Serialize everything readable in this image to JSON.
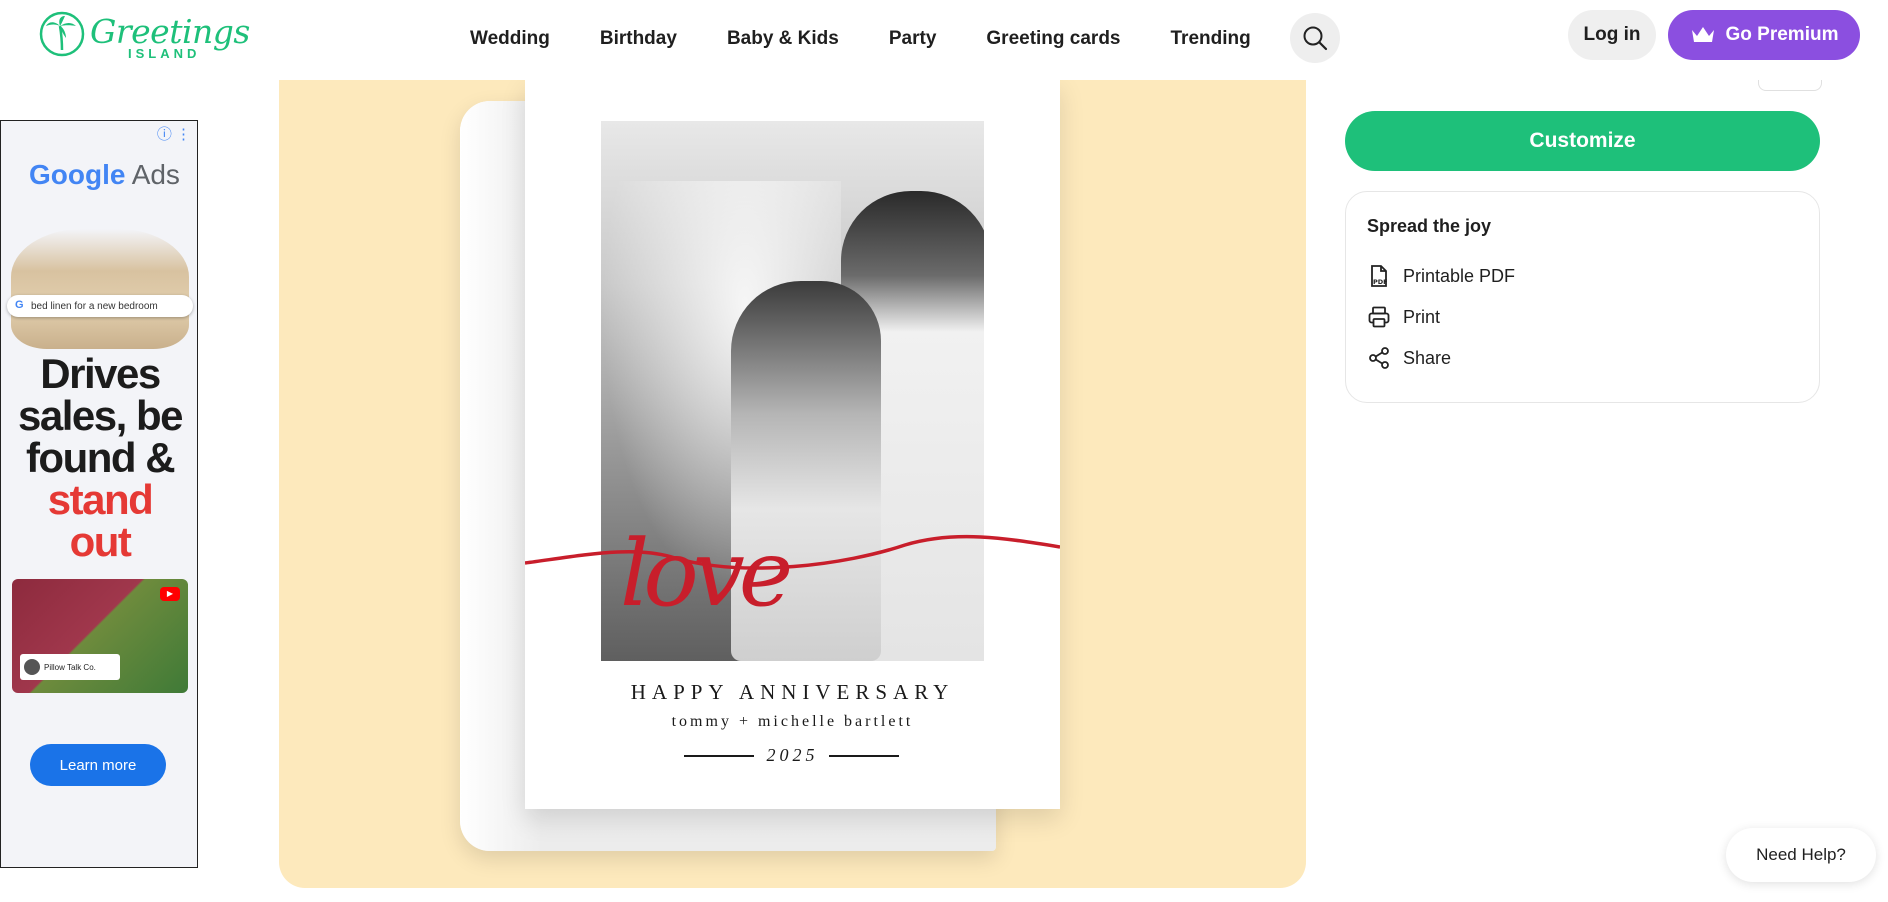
{
  "brand": {
    "name": "Greetings",
    "sub": "ISLAND"
  },
  "nav": {
    "items": [
      "Wedding",
      "Birthday",
      "Baby & Kids",
      "Party",
      "Greeting cards",
      "Trending"
    ]
  },
  "header": {
    "login_label": "Log in",
    "premium_label": "Go Premium"
  },
  "ad": {
    "brand_g": "Google",
    "brand_ads": " Ads",
    "search_text": "bed linen for a new bedroom",
    "headline_line1": "Drives",
    "headline_line2": "sales, be",
    "headline_line3": "found &",
    "headline_red1": "stand",
    "headline_red2": "out",
    "advertiser": "Pillow Talk Co.",
    "cta_label": "Learn more"
  },
  "card": {
    "script_word": "love",
    "greeting": "HAPPY ANNIVERSARY",
    "names": "tommy + michelle bartlett",
    "year": "2025",
    "accent_color": "#c81e2b"
  },
  "panel": {
    "customize_label": "Customize",
    "spread_title": "Spread the joy",
    "spread_items": [
      {
        "label": "Printable PDF",
        "icon": "pdf-icon"
      },
      {
        "label": "Print",
        "icon": "printer-icon"
      },
      {
        "label": "Share",
        "icon": "share-icon"
      }
    ]
  },
  "help": {
    "label": "Need Help?"
  },
  "colors": {
    "green": "#1ec07a",
    "purple": "#8b4fe0",
    "stage_bg": "#fde9bc"
  }
}
